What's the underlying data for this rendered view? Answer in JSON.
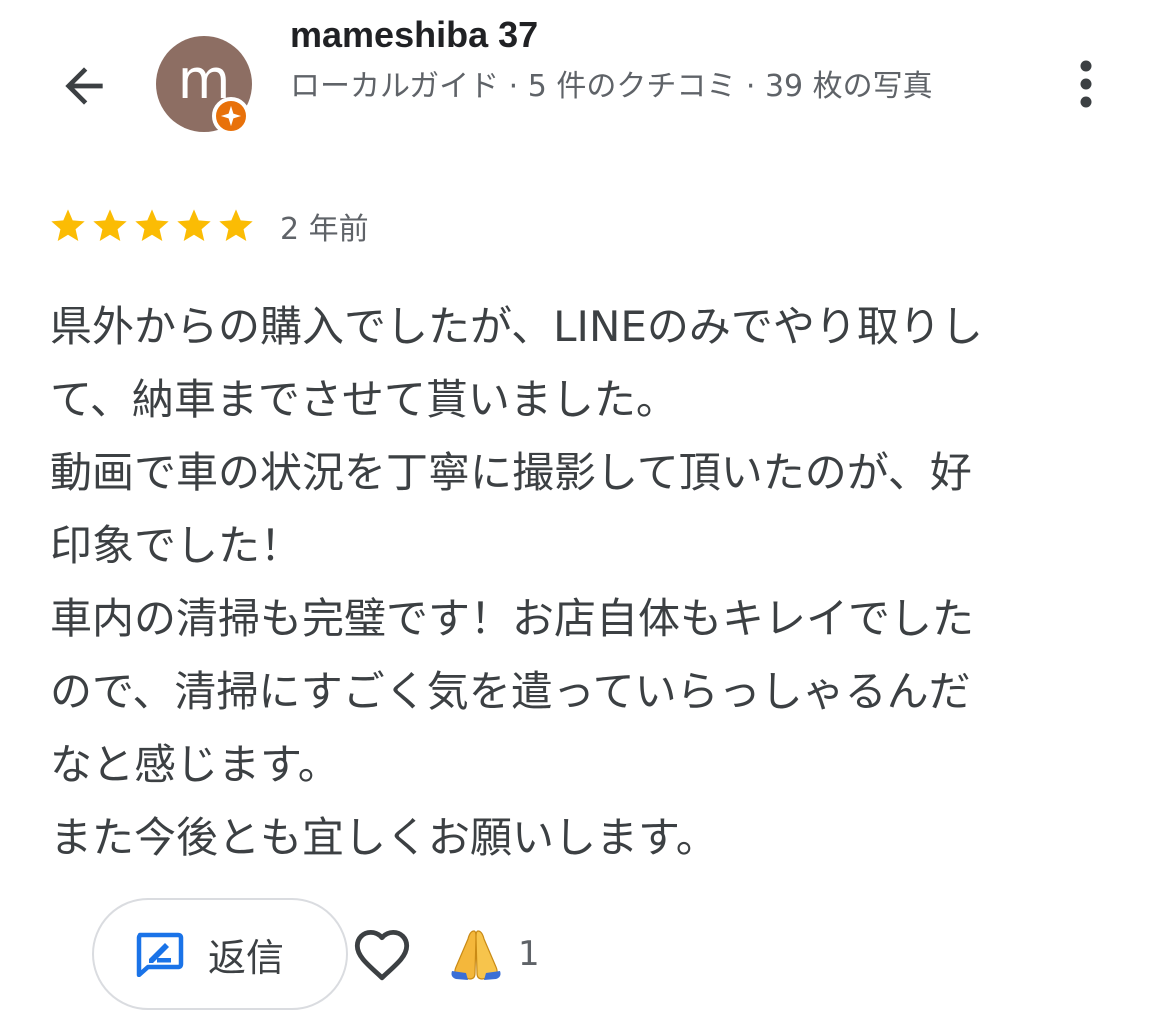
{
  "header": {
    "back_icon": "arrow-left-icon",
    "avatar_letter": "m",
    "avatar_color": "#8d6e63",
    "badge_icon": "local-guide-star-icon",
    "badge_color": "#e8710a",
    "user_name": "mameshiba 37",
    "user_meta": "ローカルガイド · 5 件のクチコミ · 39 枚の写真",
    "more_icon": "more-vertical-icon"
  },
  "review": {
    "rating": 5,
    "rating_max": 5,
    "star_color": "#fbbc04",
    "age": "2 年前",
    "lines": [
      "県外からの購入でしたが、LINEのみでやり取りし",
      "て、納車までさせて貰いました。",
      "動画で車の状況を丁寧に撮影して頂いたのが、好",
      "印象でした！",
      "車内の清掃も完璧です！お店自体もキレイでした",
      "ので、清掃にすごく気を遣っていらっしゃるんだ",
      "なと感じます。",
      "また今後とも宜しくお願いします。"
    ]
  },
  "actions": {
    "reply_icon": "reply-edit-icon",
    "reply_label": "返信",
    "reply_icon_color": "#1a73e8",
    "like_icon": "heart-outline-icon",
    "reaction_icon": "folded-hands-emoji",
    "reaction_count": "1"
  }
}
